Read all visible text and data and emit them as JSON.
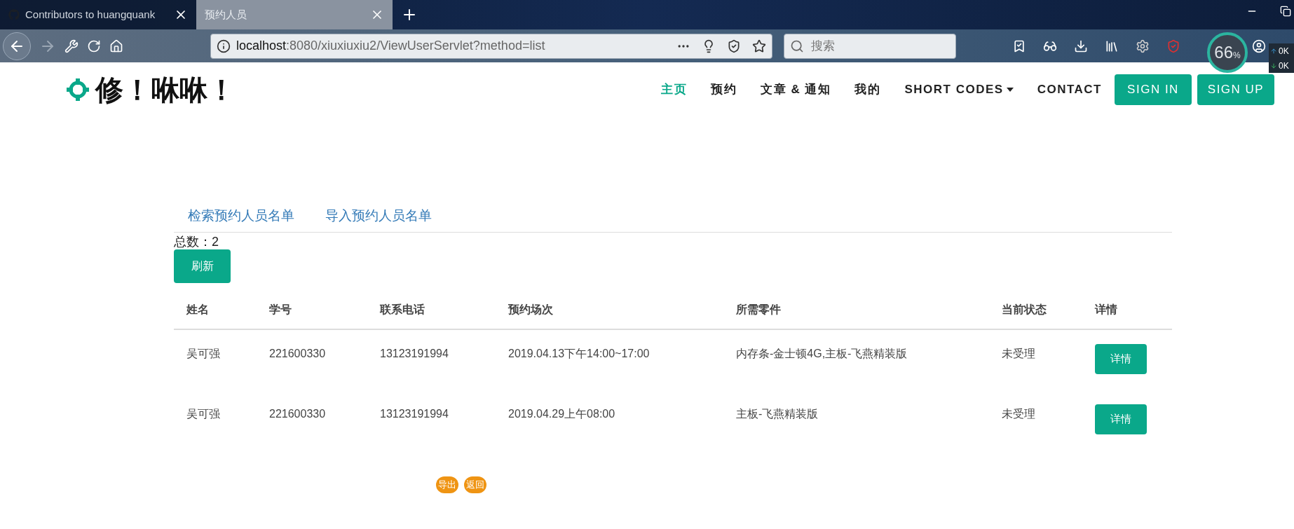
{
  "browser": {
    "tabs": [
      {
        "title": "Contributors to huangquank",
        "selected": false
      },
      {
        "title": "预约人员",
        "selected": true
      }
    ],
    "url": {
      "host": "localhost",
      "rest": ":8080/xiuxiuxiu2/ViewUserServlet?method=list"
    },
    "search": {
      "placeholder": "搜索"
    },
    "monitor": {
      "percent": "66",
      "unit": "%",
      "up": "0K",
      "down": "0K"
    }
  },
  "header": {
    "logo": "修！咻咻！",
    "nav": [
      {
        "label": "主页",
        "selected": true,
        "kind": "link"
      },
      {
        "label": "预约",
        "selected": false,
        "kind": "link"
      },
      {
        "label": "文章 & 通知",
        "selected": false,
        "kind": "link"
      },
      {
        "label": "我的",
        "selected": false,
        "kind": "link"
      },
      {
        "label": "SHORT CODES",
        "selected": false,
        "kind": "dropdown"
      },
      {
        "label": "CONTACT",
        "selected": false,
        "kind": "link"
      }
    ],
    "buttons": [
      "SIGN IN",
      "SIGN UP"
    ]
  },
  "content": {
    "tabs": [
      "检索预约人员名单",
      "导入预约人员名单"
    ],
    "total": "总数：2",
    "refresh": "刷新",
    "table": {
      "columns": [
        "姓名",
        "学号",
        "联系电话",
        "预约场次",
        "所需零件",
        "当前状态",
        "详情"
      ],
      "rows": [
        {
          "cells": [
            "吴可强",
            "221600330",
            "13123191994",
            "2019.04.13下午14:00~17:00",
            "内存条-金士顿4G,主板-飞燕精装版",
            "未受理"
          ],
          "action": "详情"
        },
        {
          "cells": [
            "吴可强",
            "221600330",
            "13123191994",
            "2019.04.29上午08:00",
            "主板-飞燕精装版",
            "未受理"
          ],
          "action": "详情"
        }
      ]
    },
    "footer_buttons": [
      "导出",
      "返回"
    ]
  }
}
